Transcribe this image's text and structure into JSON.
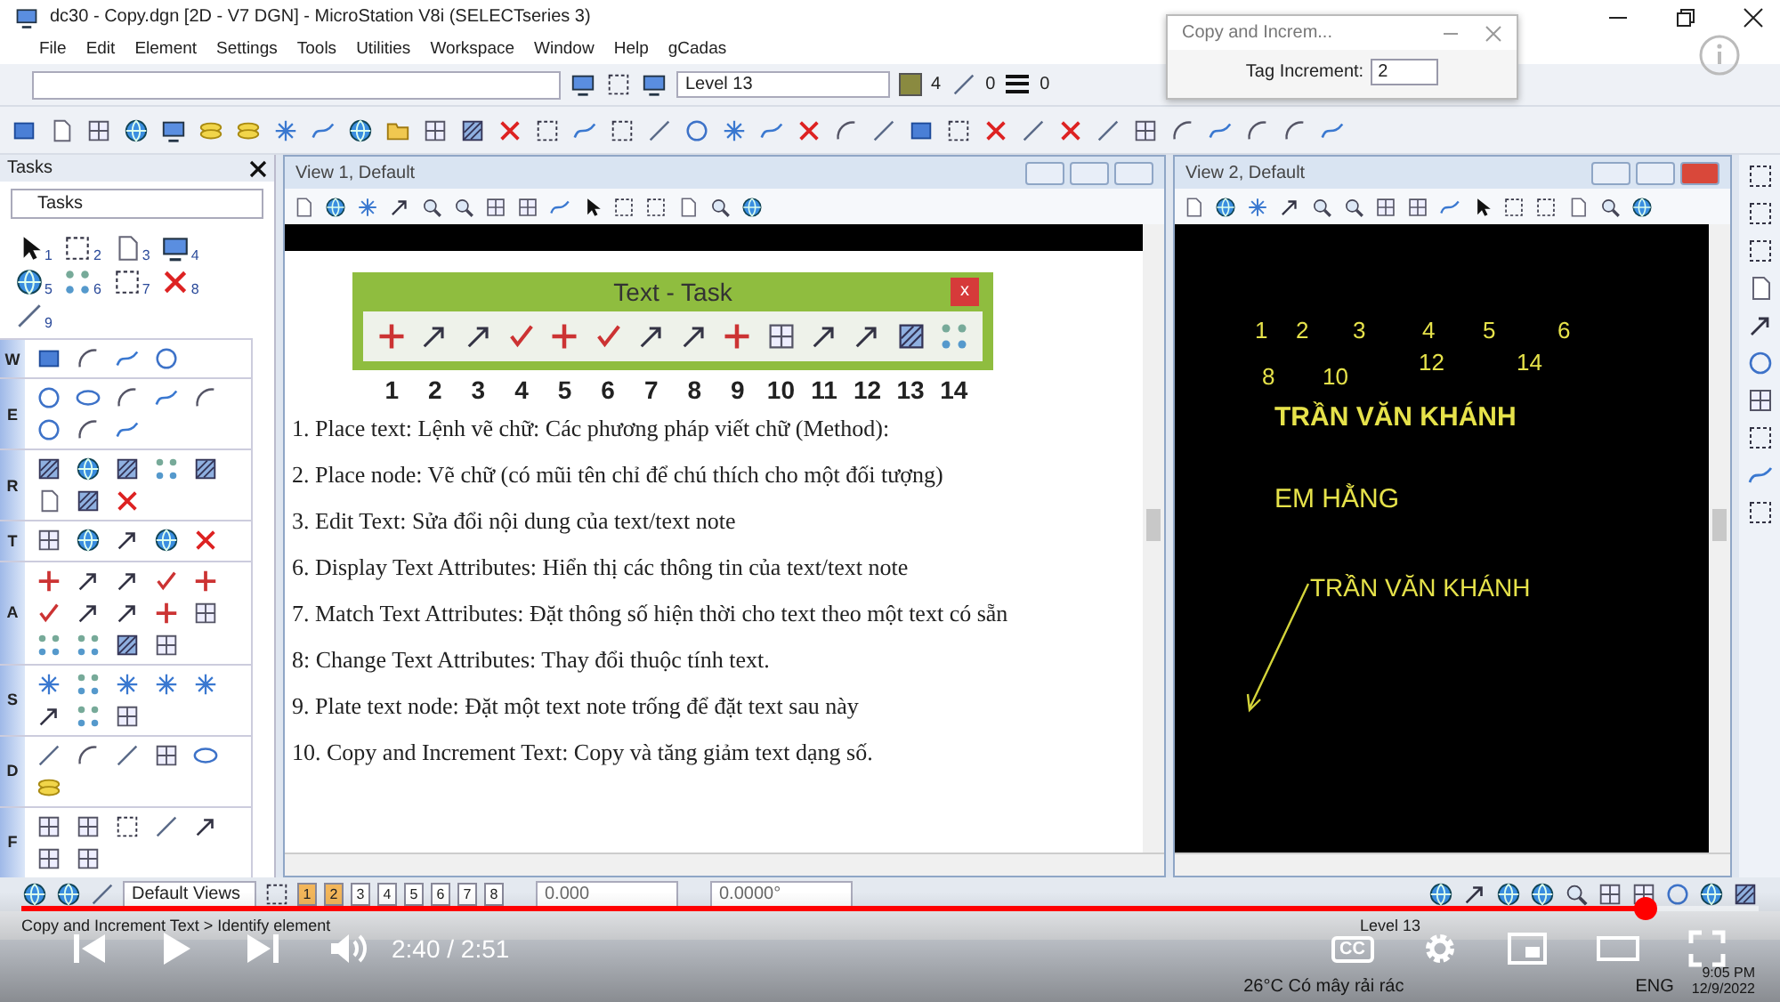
{
  "window": {
    "title": "dc30 - Copy.dgn [2D - V7 DGN] - MicroStation V8i (SELECTseries 3)"
  },
  "menu": [
    "File",
    "Edit",
    "Element",
    "Settings",
    "Tools",
    "Utilities",
    "Workspace",
    "Window",
    "Help",
    "gCadas"
  ],
  "attributes": {
    "level": "Level 13",
    "color_index": "4",
    "style": "0",
    "weight": "0"
  },
  "dialog": {
    "title": "Copy and Increm...",
    "label": "Tag Increment:",
    "value": "2"
  },
  "tasks": {
    "title": "Tasks",
    "dropdown": "Tasks",
    "quick_tools": [
      "1",
      "2",
      "3",
      "4",
      "5",
      "6",
      "7",
      "8",
      "9"
    ],
    "groups": [
      {
        "letter": "W"
      },
      {
        "letter": "E"
      },
      {
        "letter": "R"
      },
      {
        "letter": "T"
      },
      {
        "letter": "A"
      },
      {
        "letter": "S"
      },
      {
        "letter": "D"
      },
      {
        "letter": "F"
      }
    ]
  },
  "view1": {
    "title": "View 1, Default",
    "text_task": {
      "title": "Text - Task",
      "close": "x",
      "numbers": [
        "1",
        "2",
        "3",
        "4",
        "5",
        "6",
        "7",
        "8",
        "9",
        "10",
        "11",
        "12",
        "13",
        "14"
      ]
    },
    "lines": [
      "1. Place text: Lệnh vẽ chữ: Các phương pháp viết chữ (Method):",
      "2. Place node: Vẽ chữ (có mũi tên chỉ để chú thích cho một đối tượng)",
      "3. Edit Text: Sửa đổi nội dung của text/text note",
      "6. Display Text Attributes: Hiển thị các thông tin của text/text note",
      "7. Match Text Attributes: Đặt thông số hiện thời cho text theo một text có sẵn",
      "8: Change Text Attributes: Thay đổi thuộc tính text.",
      "9. Plate text node: Đặt một text note trống để đặt text sau này",
      "10. Copy and Increment Text: Copy và tăng giảm text dạng số."
    ]
  },
  "view2": {
    "title": "View 2, Default",
    "numbers": [
      "1",
      "2",
      "3",
      "4",
      "5",
      "6",
      "8",
      "10",
      "12",
      "14"
    ],
    "heading": "TRẦN VĂN KHÁNH",
    "subheading": "EM HẰNG",
    "note": "TRẦN VĂN KHÁNH"
  },
  "view_bar": {
    "views_dropdown": "Default Views",
    "view_buttons": [
      {
        "label": "1",
        "open": true
      },
      {
        "label": "2",
        "open": true
      },
      {
        "label": "3",
        "open": false
      },
      {
        "label": "4",
        "open": false
      },
      {
        "label": "5",
        "open": false
      },
      {
        "label": "6",
        "open": false
      },
      {
        "label": "7",
        "open": false
      },
      {
        "label": "8",
        "open": false
      }
    ],
    "coordinate": "0.000",
    "angle": "0.0000°"
  },
  "status_bar": {
    "prompt": "Copy and Increment Text > Identify element",
    "level": "Level 13"
  },
  "player": {
    "level": 0.935,
    "time": "2:40 / 2:51",
    "captions": "CC"
  },
  "taskbar": {
    "weather": "26°C Có mây rải rác",
    "language": "ENG",
    "time": "9:05 PM",
    "date": "12/9/2022"
  }
}
